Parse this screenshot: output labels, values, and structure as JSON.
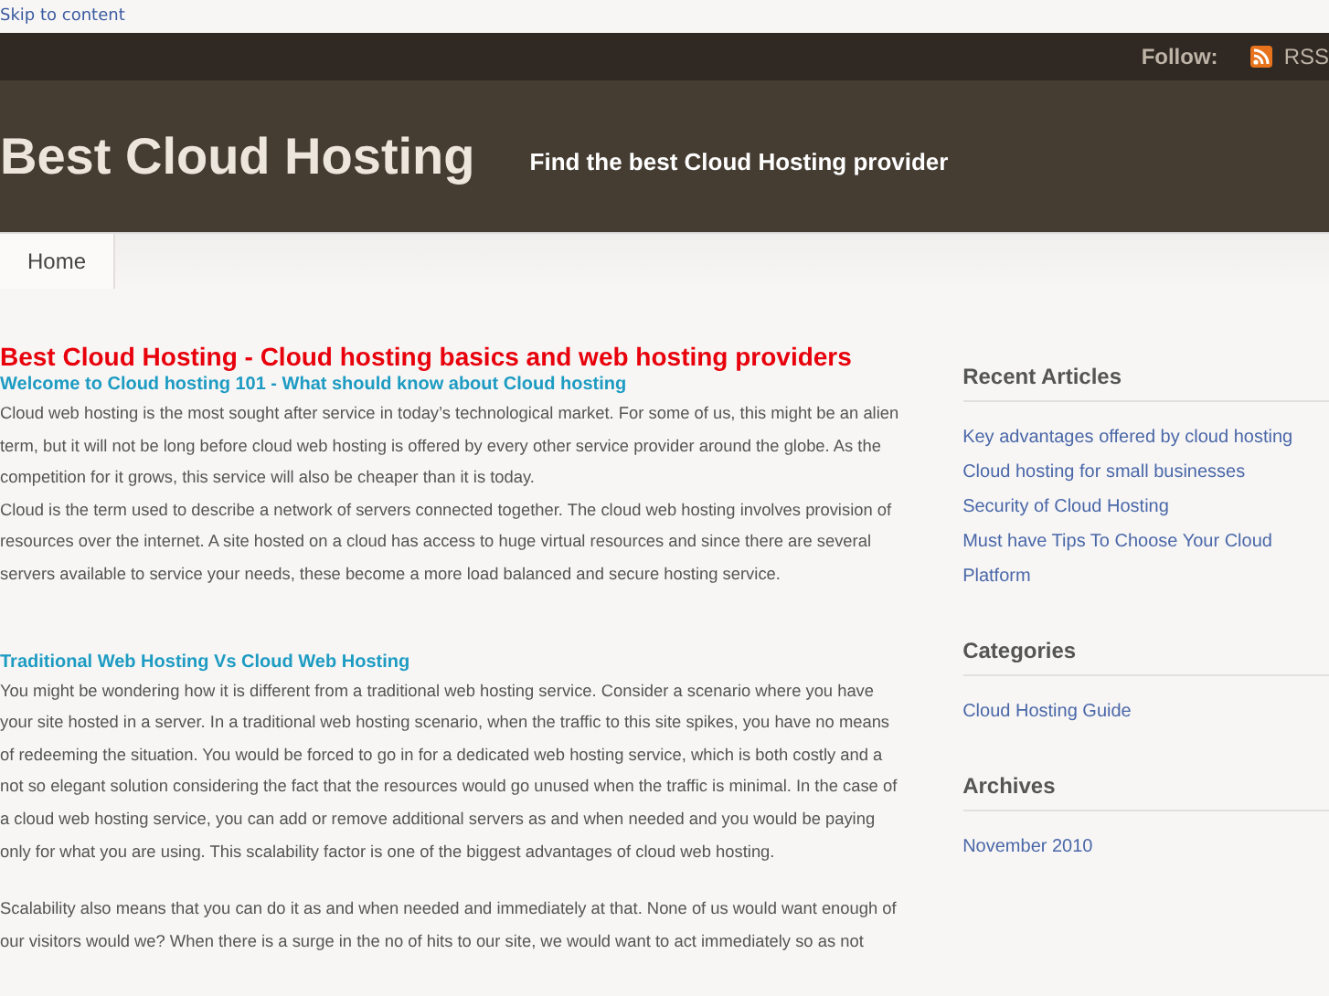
{
  "skip_link": "Skip to content",
  "top_bar": {
    "follow_label": "Follow:",
    "rss_label": "RSS"
  },
  "header": {
    "site_title": "Best Cloud Hosting",
    "tagline": "Find the best Cloud Hosting provider"
  },
  "nav": {
    "tabs": [
      {
        "label": "Home",
        "selected": true
      }
    ]
  },
  "main": {
    "title": "Best Cloud Hosting - Cloud hosting basics and web hosting providers",
    "sections": [
      {
        "heading": "Welcome to Cloud hosting 101 - What should know about Cloud hosting",
        "paragraphs": [
          "Cloud web hosting is the most sought after service in today’s technological market. For some of us, this might be an alien term, but it will not be long before cloud web hosting is offered by every other service provider around the globe. As the competition for it grows, this service will also be cheaper than it is today.",
          "Cloud is the term used to describe a network of servers connected together. The cloud web hosting involves provision of resources over the internet. A site hosted on a cloud has access to huge virtual resources and since there are several servers available to service your needs, these become a more load balanced and secure hosting service."
        ]
      },
      {
        "heading": "Traditional Web Hosting Vs Cloud Web Hosting",
        "paragraphs": [
          "You might be wondering how it is different from a traditional web hosting service. Consider a scenario where you have your site hosted in a server. In a traditional web hosting scenario, when the traffic to this site spikes, you have no means of redeeming the situation. You would be forced to go in for a dedicated web hosting service, which is both costly and a not so elegant solution considering the fact that the resources would go unused when the traffic is minimal. In the case of a cloud web hosting service, you can add or remove additional servers as and when needed and you would be paying only for what you are using. This scalability factor is one of the biggest advantages of cloud web hosting.",
          "Scalability also means that you can do it as and when needed and immediately at that. None of us would want enough of our visitors would we? When there is a surge in the no of hits to our site, we would want to act immediately so as not"
        ]
      }
    ]
  },
  "sidebar": [
    {
      "title": "Recent Articles",
      "links": [
        "Key advantages offered by cloud hosting",
        "Cloud hosting for small businesses",
        "Security of Cloud Hosting",
        "Must have Tips To Choose Your Cloud Platform"
      ]
    },
    {
      "title": "Categories",
      "links": [
        "Cloud Hosting Guide"
      ]
    },
    {
      "title": "Archives",
      "links": [
        "November 2010"
      ]
    }
  ]
}
